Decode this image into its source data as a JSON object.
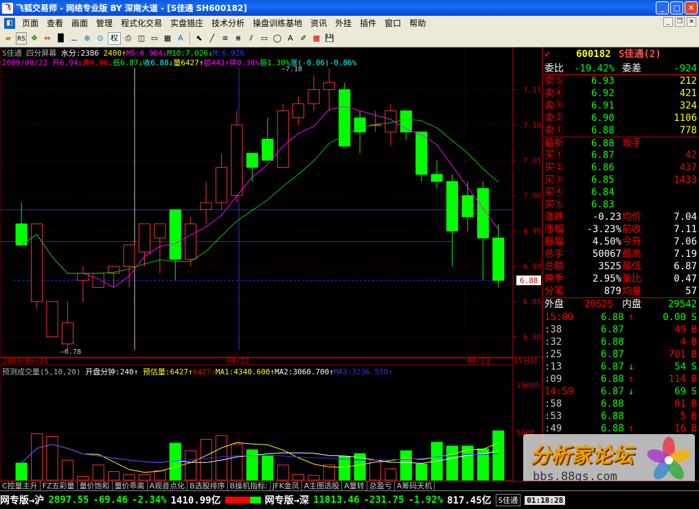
{
  "window": {
    "title": "飞狐交易师 - 网络专业版 BY 深南大道 - [S佳通 SH600182]",
    "logo_char": "飞"
  },
  "menu": [
    "页面",
    "查看",
    "画面",
    "管理",
    "程式化交易",
    "实盘猎庄",
    "技术分析",
    "操盘训练基地",
    "资讯",
    "外挂",
    "插件",
    "窗口",
    "帮助"
  ],
  "toolbar": {
    "right_label": "权"
  },
  "kline_header": {
    "l1": [
      {
        "t": "S佳通 四分屏幕 ",
        "c": "#b0b0b0"
      },
      {
        "t": "水分:2386 ",
        "c": "#fff"
      },
      {
        "t": "2400↑",
        "c": "#ff0"
      },
      {
        "t": "M5:6.964↓",
        "c": "#f0f"
      },
      {
        "t": "M10:7.026↓",
        "c": "#0f0"
      },
      {
        "t": "M:6.926",
        "c": "#33f"
      }
    ],
    "l2": [
      {
        "t": "2009/09/22 开6.94↓",
        "c": "#f0f"
      },
      {
        "t": "高6.96↓",
        "c": "#f00"
      },
      {
        "t": "低6.87↓",
        "c": "#0f0"
      },
      {
        "t": "收6.88↓",
        "c": "#0ff"
      },
      {
        "t": "量6427↑",
        "c": "#ff0"
      },
      {
        "t": "额443↑",
        "c": "#f0f"
      },
      {
        "t": "换0.38%",
        "c": "#f0f"
      },
      {
        "t": "振1.30%",
        "c": "#0f0"
      },
      {
        "t": "涨(-0.06)-0.86%",
        "c": "#0ff"
      }
    ]
  },
  "vol_header": [
    {
      "t": "预测成交量(5,10,20) ",
      "c": "#b0b0b0"
    },
    {
      "t": "开盘分钟:240↑ ",
      "c": "#fff"
    },
    {
      "t": "预估量:6427↑",
      "c": "#ff0"
    },
    {
      "t": "6427↑",
      "c": "#f00"
    },
    {
      "t": "MA1:4340.600↑",
      "c": "#ff0"
    },
    {
      "t": "MA2:3060.700↑",
      "c": "#fff"
    },
    {
      "t": "MA3:3236.550↑",
      "c": "#33f"
    }
  ],
  "axis": {
    "price_ticks": [
      "7.15",
      "7.10",
      "7.05",
      "7.00",
      "6.95",
      "6.90",
      "6.85",
      "6.80"
    ],
    "vol_ticks": [
      "10000",
      "5000"
    ],
    "dates": [
      "2009/09/21",
      "09/22",
      "09/23"
    ],
    "period": "15分钟",
    "high_label": "7.18",
    "low_label": "6.78",
    "current_price": "6.88"
  },
  "chart_data": {
    "type": "candlestick",
    "interval": "15分钟",
    "candles": [
      {
        "o": 6.96,
        "h": 6.99,
        "l": 6.93,
        "c": 6.93
      },
      {
        "o": 6.85,
        "h": 6.96,
        "l": 6.84,
        "c": 6.96
      },
      {
        "o": 6.8,
        "h": 6.85,
        "l": 6.8,
        "c": 6.85
      },
      {
        "o": 6.79,
        "h": 6.85,
        "l": 6.78,
        "c": 6.82
      },
      {
        "o": 6.88,
        "h": 6.9,
        "l": 6.85,
        "c": 6.89
      },
      {
        "o": 6.87,
        "h": 6.89,
        "l": 6.87,
        "c": 6.89
      },
      {
        "o": 6.89,
        "h": 6.89,
        "l": 6.87,
        "c": 6.9
      },
      {
        "o": 6.9,
        "h": 6.9,
        "l": 6.87,
        "c": 6.93
      },
      {
        "o": 6.92,
        "h": 6.96,
        "l": 6.9,
        "c": 6.96
      },
      {
        "o": 6.94,
        "h": 6.96,
        "l": 6.89,
        "c": 6.96
      },
      {
        "o": 6.98,
        "h": 6.98,
        "l": 6.88,
        "c": 6.91
      },
      {
        "o": 6.91,
        "h": 6.97,
        "l": 6.9,
        "c": 6.96
      },
      {
        "o": 6.98,
        "h": 7.02,
        "l": 6.96,
        "c": 6.99
      },
      {
        "o": 6.99,
        "h": 7.06,
        "l": 6.98,
        "c": 7.04
      },
      {
        "o": 7.0,
        "h": 7.12,
        "l": 6.99,
        "c": 7.1
      },
      {
        "o": 7.06,
        "h": 7.04,
        "l": 7.02,
        "c": 7.04
      },
      {
        "o": 7.08,
        "h": 7.11,
        "l": 7.06,
        "c": 7.05
      },
      {
        "o": 7.04,
        "h": 7.13,
        "l": 7.04,
        "c": 7.12
      },
      {
        "o": 7.11,
        "h": 7.14,
        "l": 7.1,
        "c": 7.13
      },
      {
        "o": 7.13,
        "h": 7.17,
        "l": 7.12,
        "c": 7.15
      },
      {
        "o": 7.15,
        "h": 7.18,
        "l": 7.12,
        "c": 7.16
      },
      {
        "o": 7.15,
        "h": 7.16,
        "l": 7.08,
        "c": 7.07
      },
      {
        "o": 7.11,
        "h": 7.12,
        "l": 7.06,
        "c": 7.09
      },
      {
        "o": 7.1,
        "h": 7.12,
        "l": 7.09,
        "c": 7.1
      },
      {
        "o": 7.09,
        "h": 7.13,
        "l": 7.07,
        "c": 7.12
      },
      {
        "o": 7.12,
        "h": 7.12,
        "l": 7.08,
        "c": 7.09
      },
      {
        "o": 7.09,
        "h": 7.09,
        "l": 7.02,
        "c": 7.03
      },
      {
        "o": 7.03,
        "h": 7.05,
        "l": 7.01,
        "c": 7.02
      },
      {
        "o": 7.02,
        "h": 7.03,
        "l": 6.9,
        "c": 6.95
      },
      {
        "o": 7.0,
        "h": 7.02,
        "l": 6.95,
        "c": 6.97
      },
      {
        "o": 7.01,
        "h": 7.02,
        "l": 6.88,
        "c": 6.94
      },
      {
        "o": 6.94,
        "h": 6.96,
        "l": 6.87,
        "c": 6.88
      }
    ],
    "volume": [
      1800,
      4900,
      4600,
      2100,
      400,
      1600,
      900,
      600,
      600,
      1000,
      3900,
      3100,
      4300,
      4700,
      3800,
      3200,
      2600,
      1600,
      600,
      500,
      1600,
      2500,
      2800,
      2100,
      1200,
      3100,
      1700,
      4000,
      3600,
      3600,
      3300,
      5200
    ]
  },
  "quote": {
    "code": "600182",
    "name": "S佳通(2)",
    "weibi_label": "委比",
    "weibi_val": "-19.42%",
    "weicha_label": "委差",
    "weicha_val": "-924",
    "sells": [
      {
        "l": "卖⑤",
        "p": "6.93",
        "v": "212"
      },
      {
        "l": "卖④",
        "p": "6.92",
        "v": "421"
      },
      {
        "l": "卖③",
        "p": "6.91",
        "v": "324"
      },
      {
        "l": "卖②",
        "p": "6.90",
        "v": "1106"
      },
      {
        "l": "卖①",
        "p": "6.88",
        "v": "778"
      }
    ],
    "latest_label": "最新",
    "latest": "6.88",
    "xs_label": "现手",
    "buys": [
      {
        "l": "买①",
        "p": "6.87",
        "v": "42"
      },
      {
        "l": "买②",
        "p": "6.86",
        "v": "437"
      },
      {
        "l": "买③",
        "p": "6.85",
        "v": "1433"
      },
      {
        "l": "买④",
        "p": "6.84",
        "v": ""
      },
      {
        "l": "买⑤",
        "p": "6.83",
        "v": ""
      }
    ],
    "stats": [
      {
        "l1": "涨跌",
        "v1": "-0.23",
        "l2": "均价",
        "v2": "7.04"
      },
      {
        "l1": "涨幅",
        "v1": "-3.23%",
        "l2": "前收",
        "v2": "7.11"
      },
      {
        "l1": "振幅",
        "v1": "4.50%",
        "l2": "今开",
        "v2": "7.06"
      },
      {
        "l1": "总手",
        "v1": "50067",
        "l2": "最高",
        "v2": "7.19"
      },
      {
        "l1": "总额",
        "v1": "3525",
        "l2": "最低",
        "v2": "6.87"
      },
      {
        "l1": "换手",
        "v1": "2.95%",
        "l2": "量比",
        "v2": "0.47"
      },
      {
        "l1": "分笔",
        "v1": "879",
        "l2": "均量",
        "v2": "57"
      }
    ],
    "waipan_label": "外盘",
    "waipan": "20525",
    "neipan_label": "内盘",
    "neipan": "29542",
    "ticks": [
      {
        "t": "15:00",
        "p": "6.88",
        "a": "↑",
        "v": "0.00",
        "s": "S"
      },
      {
        "t": ":38",
        "p": "6.87",
        "a": "",
        "v": "49",
        "s": "B"
      },
      {
        "t": ":32",
        "p": "6.88",
        "a": "",
        "v": "4",
        "s": "B"
      },
      {
        "t": ":25",
        "p": "6.87",
        "a": "",
        "v": "701",
        "s": "B"
      },
      {
        "t": ":13",
        "p": "6.87",
        "a": "↓",
        "v": "54",
        "s": "S"
      },
      {
        "t": ":09",
        "p": "6.88",
        "a": "↑",
        "v": "114",
        "s": "B"
      },
      {
        "t": "14:59",
        "p": "6.87",
        "a": "↓",
        "v": "69",
        "s": "S"
      },
      {
        "t": ":58",
        "p": "6.88",
        "a": "",
        "v": "61",
        "s": "B"
      },
      {
        "t": ":53",
        "p": "6.88",
        "a": "",
        "v": "5",
        "s": "B"
      },
      {
        "t": ":49",
        "p": "6.88",
        "a": "↑",
        "v": "16",
        "s": "B"
      }
    ]
  },
  "tabs": [
    "C控量主升",
    "FZ五彩量",
    "量价饱和",
    "量价乖离",
    "A观音点化",
    "B选股排序",
    "B操机指标:",
    "JFK金凤",
    "A主图选股",
    "A量转",
    "总盈亏",
    "A筹码天机"
  ],
  "status": {
    "sh_label": "网专版→沪",
    "sh_index": "2897.55",
    "sh_chg": "-69.46",
    "sh_pct": "-2.34%",
    "sh_amt": "1410.99亿",
    "sz_label": "网专版→深",
    "sz_index": "11813.46",
    "sz_chg": "-231.75",
    "sz_pct": "-1.92%",
    "sz_amt": "817.45亿",
    "stock": "S佳通",
    "time": "01:18:28"
  },
  "watermark": {
    "title": "分析家论坛",
    "url": "bbs.88gs.com"
  }
}
